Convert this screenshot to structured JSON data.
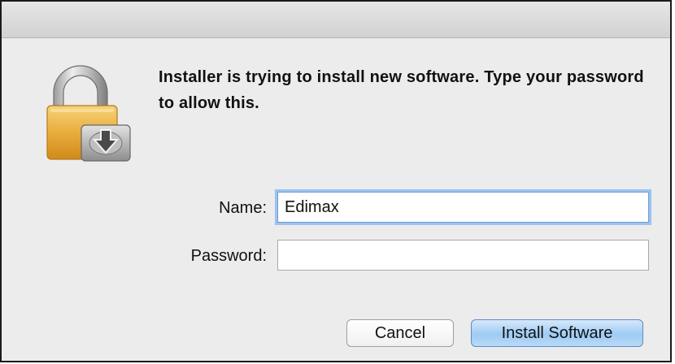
{
  "dialog": {
    "message": "Installer is trying to install new software. Type your password to allow this.",
    "icon": "lock-with-download-icon"
  },
  "form": {
    "name_label": "Name:",
    "name_value": "Edimax",
    "password_label": "Password:",
    "password_value": ""
  },
  "buttons": {
    "cancel_label": "Cancel",
    "install_label": "Install Software"
  }
}
